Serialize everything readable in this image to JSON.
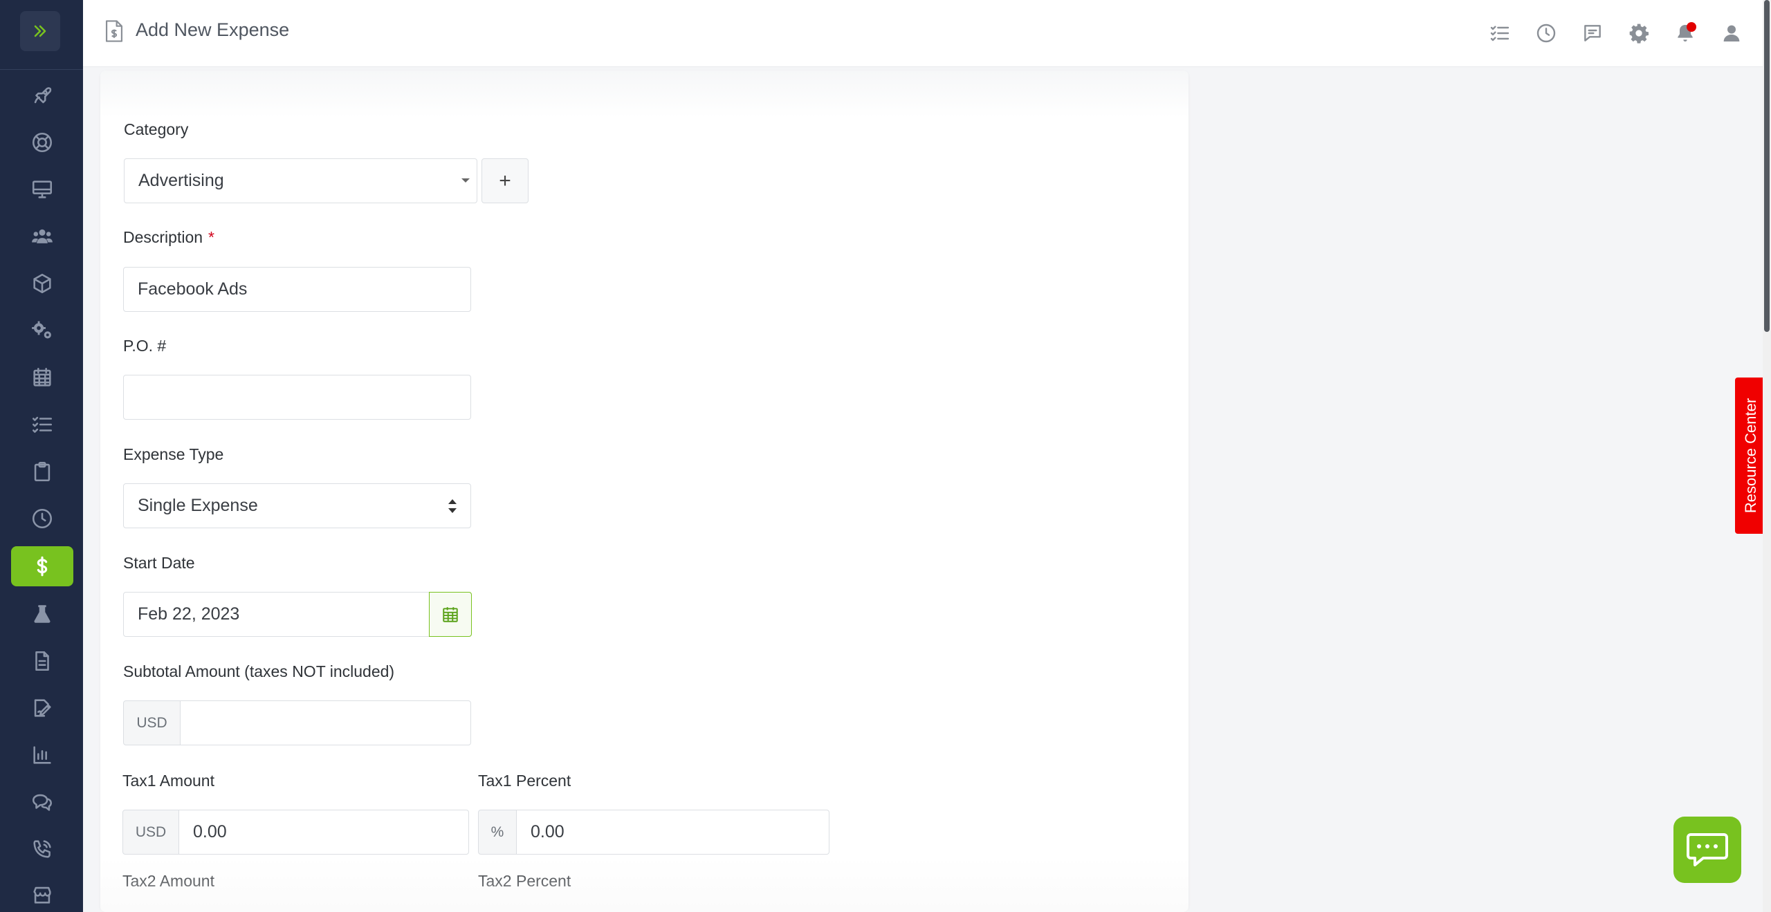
{
  "header": {
    "title": "Add New Expense",
    "notification_dot_color": "#e10000"
  },
  "sidebar": {
    "toggle_icon": "double-chevron-right-icon",
    "accent": "#78c21f",
    "items": [
      {
        "icon": "rocket-icon"
      },
      {
        "icon": "lifebuoy-icon"
      },
      {
        "icon": "monitor-icon"
      },
      {
        "icon": "users-icon"
      },
      {
        "icon": "box-icon"
      },
      {
        "icon": "gears-icon"
      },
      {
        "icon": "calendar-icon"
      },
      {
        "icon": "tasks-icon"
      },
      {
        "icon": "clipboard-icon"
      },
      {
        "icon": "clock-icon"
      },
      {
        "icon": "dollar-icon",
        "active": true
      },
      {
        "icon": "flask-icon"
      },
      {
        "icon": "document-icon"
      },
      {
        "icon": "contract-icon"
      },
      {
        "icon": "bar-chart-icon"
      },
      {
        "icon": "chat-icon"
      },
      {
        "icon": "phone-icon"
      },
      {
        "icon": "store-icon"
      }
    ]
  },
  "topbar_icons": [
    "tasks-icon",
    "clock-icon",
    "message-icon",
    "gear-icon",
    "bell-icon",
    "user-icon"
  ],
  "form": {
    "category": {
      "label": "Category",
      "value": "Advertising",
      "add_label": "+"
    },
    "description": {
      "label": "Description",
      "required_mark": "*",
      "value": "Facebook Ads"
    },
    "po": {
      "label": "P.O. #",
      "value": ""
    },
    "expense_type": {
      "label": "Expense Type",
      "value": "Single Expense"
    },
    "start_date": {
      "label": "Start Date",
      "value": "Feb 22, 2023"
    },
    "subtotal": {
      "label": "Subtotal Amount (taxes NOT included)",
      "currency": "USD",
      "value": ""
    },
    "tax1_amount": {
      "label": "Tax1 Amount",
      "currency": "USD",
      "value": "0.00"
    },
    "tax1_percent": {
      "label": "Tax1 Percent",
      "unit": "%",
      "value": "0.00"
    },
    "tax2_amount": {
      "label": "Tax2 Amount"
    },
    "tax2_percent": {
      "label": "Tax2 Percent"
    }
  },
  "widgets": {
    "resource_center": "Resource Center",
    "resource_color": "#f00000",
    "chat_color": "#78c21f"
  }
}
